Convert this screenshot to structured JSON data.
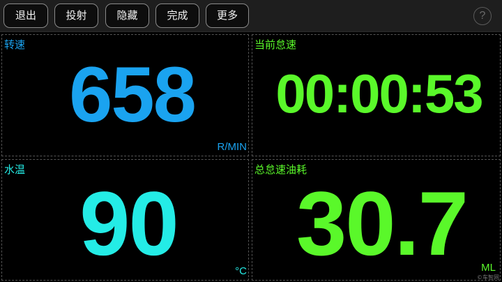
{
  "toolbar": {
    "buttons": [
      {
        "label": "退出"
      },
      {
        "label": "投射"
      },
      {
        "label": "隐藏"
      },
      {
        "label": "完成"
      },
      {
        "label": "更多"
      }
    ],
    "help_label": "?"
  },
  "panels": {
    "rpm": {
      "label": "转速",
      "value": "658",
      "unit": "R/MIN",
      "color": "#1aa3f0"
    },
    "idle_time": {
      "label": "当前怠速",
      "value": "00:00:53",
      "unit": "",
      "color": "#5af82a"
    },
    "water_temp": {
      "label": "水温",
      "value": "90",
      "unit": "°C",
      "color": "#24ece6"
    },
    "idle_fuel": {
      "label": "总怠速油耗",
      "value": "30.7",
      "unit": "ML",
      "color": "#5af82a"
    }
  },
  "watermark": "©车智网",
  "colors": {
    "background": "#000000",
    "toolbar": "#1e1e1e"
  }
}
